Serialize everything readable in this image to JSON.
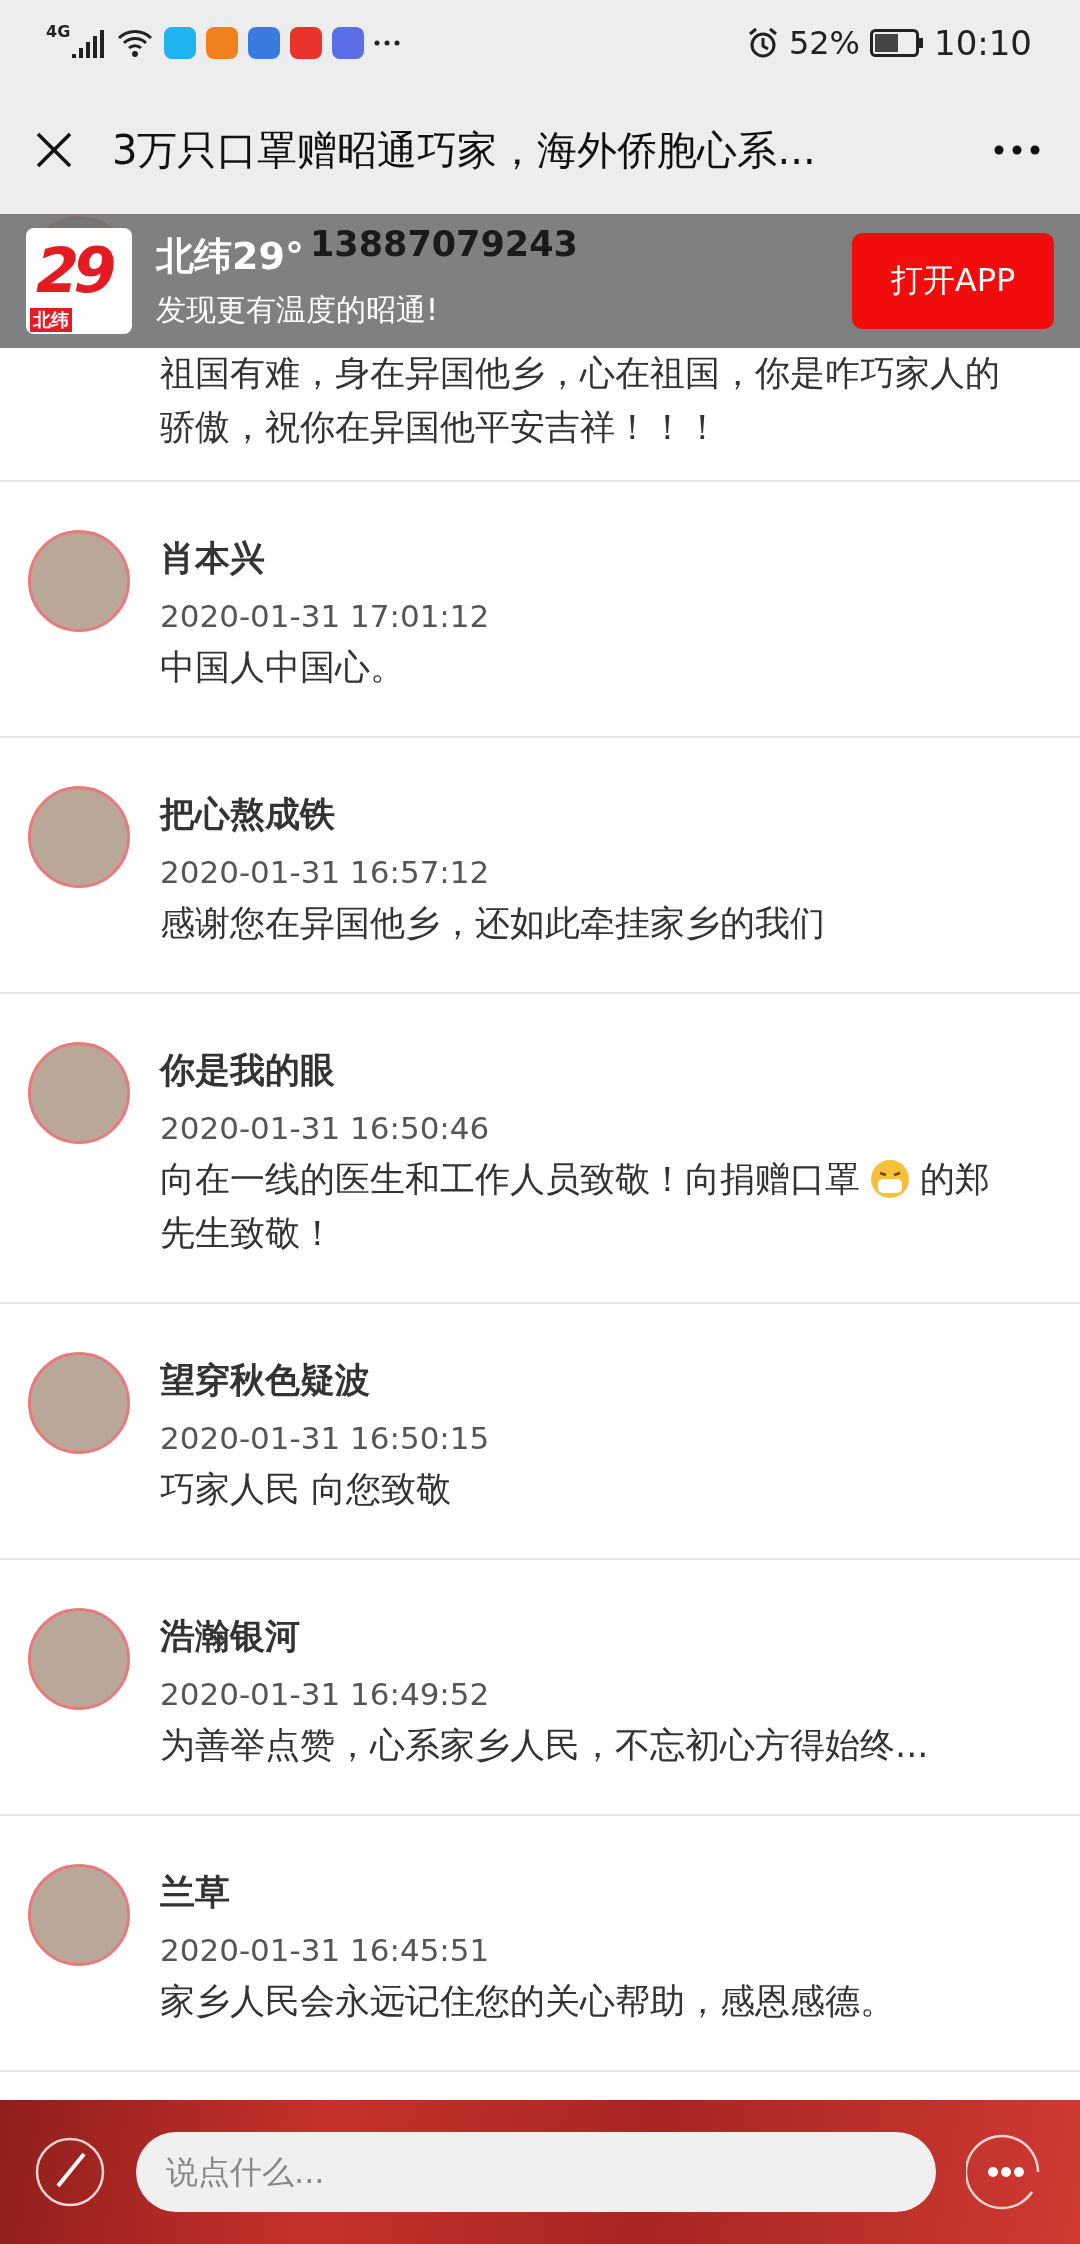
{
  "status_bar": {
    "network": "4G",
    "notification_icons": [
      {
        "color": "#1fb3f0"
      },
      {
        "color": "#f3801f"
      },
      {
        "color": "#3a7be0"
      },
      {
        "color": "#e8342a"
      },
      {
        "color": "#5a6ee6"
      }
    ],
    "battery": "52%",
    "time": "10:10"
  },
  "title_bar": {
    "title": "3万只口罩赠昭通巧家，海外侨胞心系..."
  },
  "app_banner": {
    "logo": {
      "numeral": "29",
      "caption": "北纬"
    },
    "name": "北纬29°",
    "slogan": "发现更有温度的昭通!",
    "button": "打开APP"
  },
  "comments": [
    {
      "name": "13887079243",
      "content": "祖国有难，身在异国他乡，心在祖国，你是咋巧家人的骄傲，祝你在异国他平安吉祥！！！"
    },
    {
      "name": "肖本兴",
      "date": "2020-01-31 17:01:12",
      "content": "中国人中国心。"
    },
    {
      "name": "把心熬成铁",
      "date": "2020-01-31 16:57:12",
      "content": "感谢您在异国他乡，还如此牵挂家乡的我们"
    },
    {
      "name": "你是我的眼",
      "date": "2020-01-31 16:50:46",
      "content_lines": [
        [
          {
            "kind": "text",
            "text": "向在一线的医生和工作人员致敬！向捐赠口罩"
          },
          {
            "kind": "emoji"
          },
          {
            "kind": "text",
            "text": "的郑"
          }
        ],
        [
          {
            "kind": "text",
            "text": "先生致敬！"
          }
        ]
      ]
    },
    {
      "name": "望穿秋色疑波",
      "date": "2020-01-31 16:50:15",
      "content": "巧家人民 向您致敬"
    },
    {
      "name": "浩瀚银河",
      "date": "2020-01-31 16:49:52",
      "content": "为善举点赞，心系家乡人民，不忘初心方得始终..."
    },
    {
      "name": "兰草",
      "date": "2020-01-31 16:45:51",
      "content": "家乡人民会永远记住您的关心帮助，感恩感德。"
    }
  ],
  "comment_bar": {
    "placeholder": "说点什么..."
  }
}
